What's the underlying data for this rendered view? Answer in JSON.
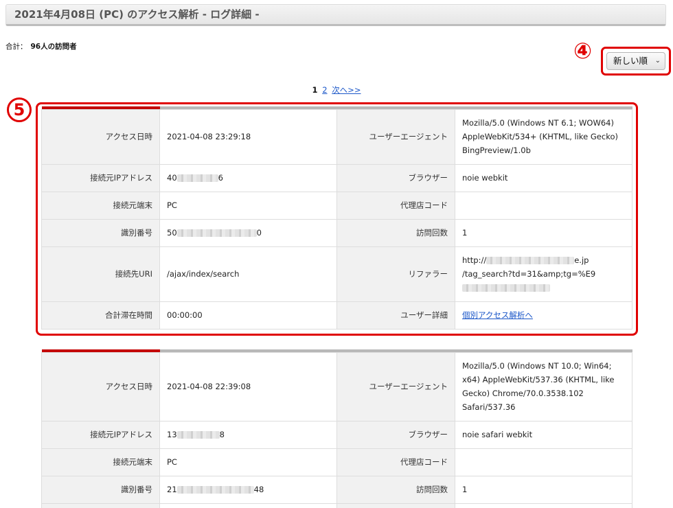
{
  "header": {
    "title": "2021年4月08日 (PC) のアクセス解析 - ログ詳細 -"
  },
  "summary": {
    "total_label": "合計：",
    "total_value": "96人の訪問者"
  },
  "badges": {
    "four": "④",
    "five": "5"
  },
  "sort": {
    "selected": "新しい順",
    "chevron": "⌄"
  },
  "pagination": {
    "current": "1",
    "page2": "2",
    "next": "次へ>>"
  },
  "labels": {
    "access_time": "アクセス日時",
    "user_agent": "ユーザーエージェント",
    "ip": "接続元IPアドレス",
    "browser": "ブラウザー",
    "device": "接続元端末",
    "agency": "代理店コード",
    "id": "識別番号",
    "visits": "訪問回数",
    "uri": "接続先URI",
    "referrer": "リファラー",
    "stay": "合計滞在時間",
    "user_detail": "ユーザー詳細"
  },
  "records": [
    {
      "access_time": "2021-04-08 23:29:18",
      "ua_lines": [
        "Mozilla/5.0 (Windows NT 6.1; WOW64)",
        "AppleWebKit/534+ (KHTML, like Gecko)",
        "BingPreview/1.0b"
      ],
      "ip_start": "40",
      "ip_end": "6",
      "browser": "noie webkit",
      "device": "PC",
      "agency": "",
      "id_start": "50",
      "id_end": "0",
      "visits": "1",
      "uri": "/ajax/index/search",
      "ref_start": "http://",
      "ref_end": "e.jp",
      "ref_line2": "/tag_search?td=31&amp;tg=%E9",
      "stay": "00:00:00",
      "user_detail": "個別アクセス解析へ"
    },
    {
      "access_time": "2021-04-08 22:39:08",
      "ua_lines": [
        "Mozilla/5.0 (Windows NT 10.0; Win64;",
        "x64) AppleWebKit/537.36 (KHTML, like",
        "Gecko) Chrome/70.0.3538.102",
        "Safari/537.36"
      ],
      "ip_start": "13",
      "ip_end": "8",
      "browser": "noie safari webkit",
      "device": "PC",
      "agency": "",
      "id_start": "21",
      "id_end": "48",
      "visits": "1"
    }
  ]
}
